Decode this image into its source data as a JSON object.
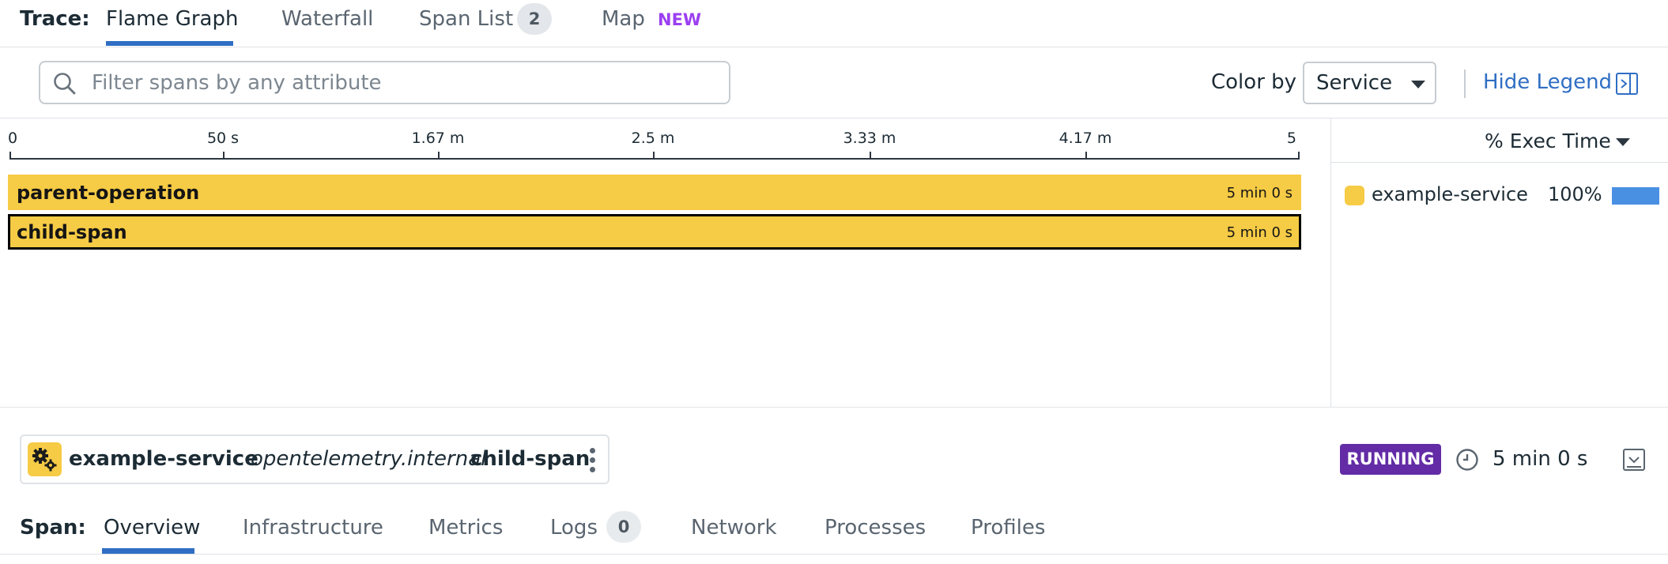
{
  "trace_tabs": {
    "label": "Trace:",
    "tabs": [
      "Flame Graph",
      "Waterfall",
      "Span List",
      "Map"
    ],
    "span_count": "2",
    "map_badge": "NEW",
    "active": "Flame Graph"
  },
  "filter": {
    "placeholder": "Filter spans by any attribute",
    "value": ""
  },
  "color_by": {
    "label": "Color by",
    "value": "Service"
  },
  "legend_toggle": "Hide Legend",
  "timeline": {
    "ticks": [
      "0",
      "50 s",
      "1.67 m",
      "2.5 m",
      "3.33 m",
      "4.17 m",
      "5"
    ]
  },
  "spans": [
    {
      "name": "parent-operation",
      "duration": "5 min 0 s",
      "selected": false
    },
    {
      "name": "child-span",
      "duration": "5 min 0 s",
      "selected": true
    }
  ],
  "legend": {
    "header": "% Exec Time",
    "items": [
      {
        "service": "example-service",
        "percent": "100%",
        "share": 1.0,
        "color": "#f6cb45"
      }
    ]
  },
  "span_detail": {
    "service": "example-service",
    "resource": "opentelemetry.internal",
    "operation": "child-span",
    "status": "RUNNING",
    "duration": "5 min 0 s"
  },
  "span_tabs": {
    "label": "Span:",
    "tabs": [
      "Overview",
      "Infrastructure",
      "Metrics",
      "Logs",
      "Network",
      "Processes",
      "Profiles"
    ],
    "logs_count": "0",
    "active": "Overview"
  },
  "colors": {
    "accent": "#2f6ec4",
    "span": "#f6cb45",
    "running": "#632ca6",
    "new_badge": "#9b3ff0"
  }
}
